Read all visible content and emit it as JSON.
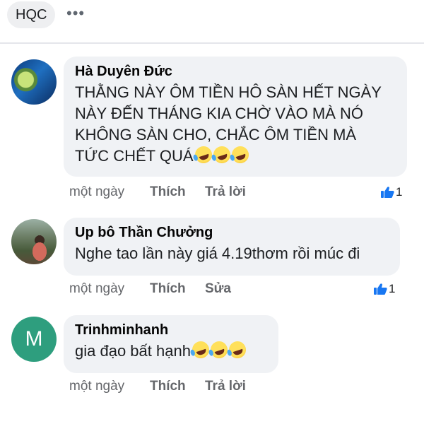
{
  "header": {
    "chip_label": "HQC",
    "more_glyph": "•••"
  },
  "comments": [
    {
      "author": "Hà Duyên Đức",
      "text": "THẰNG NÀY ÔM TIỀN HÔ SÀN HẾT NGÀY\nNÀY ĐẾN THÁNG KIA CHỜ VÀO MÀ NÓ\nKHÔNG SÀN CHO, CHẮC ÔM TIỀN MÀ\nTỨC CHẾT QUÁ",
      "emoji": "rolling-on-floor-laughing-emoji x3",
      "time": "một ngày",
      "like_label": "Thích",
      "reply_label": "Trả lời",
      "reaction_count": "1"
    },
    {
      "author": "Up bô Thần Chưởng",
      "text": "Nghe tao lần này giá 4.19thơm rồi múc đi",
      "time": "một ngày",
      "like_label": "Thích",
      "reply_label": "Sửa",
      "reaction_count": "1"
    },
    {
      "author": "Trinhminhanh",
      "avatar_initial": "M",
      "text": "gia đạo bất hạnh",
      "emoji": "rolling-on-floor-laughing-emoji x3",
      "time": "một ngày",
      "like_label": "Thích",
      "reply_label": "Trả lời"
    }
  ],
  "colors": {
    "bubble_bg": "#f0f2f5",
    "meta_text": "#65676b",
    "like_blue": "#1877f2",
    "avatar_m_bg": "#2e9e7e"
  }
}
